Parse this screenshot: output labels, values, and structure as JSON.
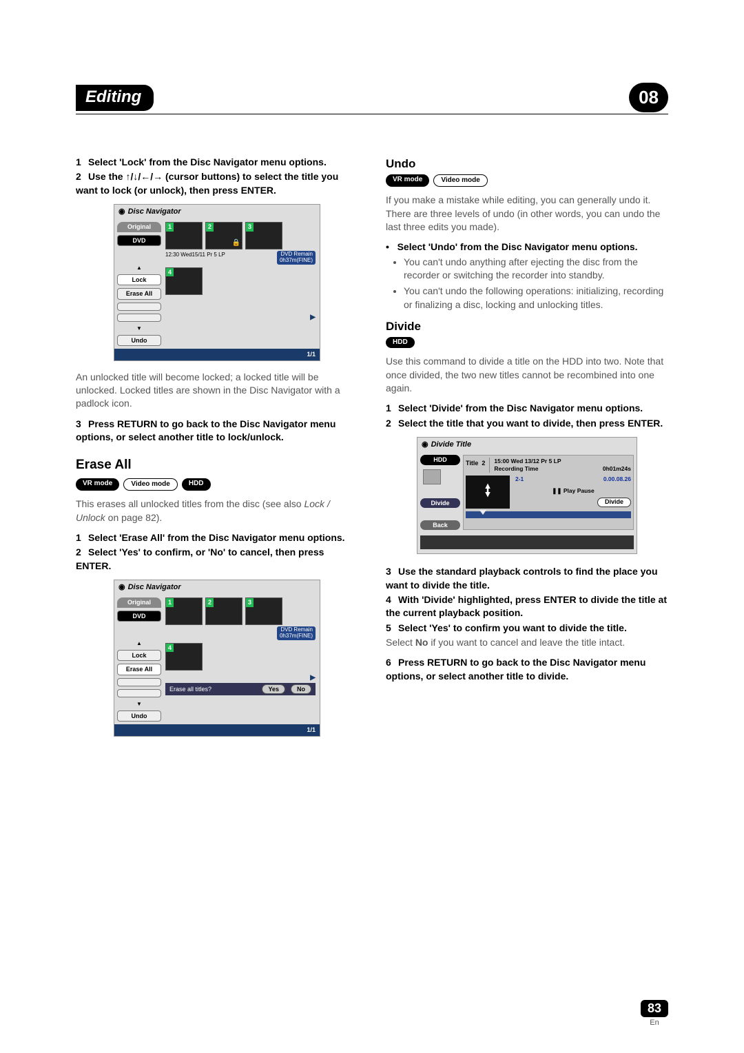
{
  "header": {
    "chapter": "Editing",
    "page_badge": "08"
  },
  "left": {
    "step1": "Select 'Lock' from the Disc Navigator menu options.",
    "step2": "Use the ↑/↓/←/→ (cursor buttons) to select the title you want to lock (or unlock), then press ENTER.",
    "after_img1": "An unlocked title will become locked; a locked title will be unlocked. Locked titles are shown in the Disc Navigator with a padlock icon.",
    "step3": "Press RETURN to go back to the Disc Navigator menu options, or select another title to lock/unlock.",
    "erase_all_h": "Erase All",
    "badges": {
      "vr": "VR mode",
      "video": "Video mode",
      "hdd": "HDD"
    },
    "erase_intro_a": "This erases all unlocked titles from the disc (see also ",
    "erase_intro_link": "Lock / Unlock",
    "erase_intro_b": " on page 82).",
    "ea_step1": "Select 'Erase All' from the Disc Navigator menu options.",
    "ea_step2": "Select 'Yes' to confirm, or 'No' to cancel, then press ENTER."
  },
  "right": {
    "undo_h": "Undo",
    "badges": {
      "vr": "VR mode",
      "video": "Video mode"
    },
    "undo_intro": "If you make a mistake while editing, you can generally undo it. There are three levels of undo (in other words, you can undo the last three edits you made).",
    "undo_bullet_lead": "Select 'Undo' from the Disc Navigator menu options.",
    "undo_b1": "You can't undo anything after ejecting the disc from the recorder or switching the recorder into standby.",
    "undo_b2": "You can't undo the following operations: initializing, recording or finalizing a disc, locking and unlocking titles.",
    "divide_h": "Divide",
    "hdd_badge": "HDD",
    "divide_intro": "Use this command to divide a title on the HDD into two. Note that once divided, the two new titles cannot be recombined into one again.",
    "dv_step1": "Select 'Divide' from the Disc Navigator menu options.",
    "dv_step2": "Select the title that you want to divide, then press ENTER.",
    "dv_step3": "Use the standard playback controls to find the place you want to divide the title.",
    "dv_step4": "With 'Divide' highlighted, press ENTER to divide the title at the current playback position.",
    "dv_step5": "Select 'Yes' to confirm you want to divide the title.",
    "dv_step5_body_a": "Select ",
    "dv_step5_body_no": "No",
    "dv_step5_body_b": " if you want to cancel and leave the title intact.",
    "dv_step6": "Press RETURN to go back to the Disc Navigator menu options, or select another title to divide."
  },
  "nav_shot": {
    "title": "Disc Navigator",
    "tab": "Original",
    "dvd": "DVD",
    "lock": "Lock",
    "erase": "Erase All",
    "undo": "Undo",
    "info_left": "12:30 Wed15/11  Pr 5   LP",
    "remain1": "DVD Remain",
    "remain2": "0h37m(FINE)",
    "page": "1/1",
    "erase_q": "Erase all titles?",
    "yes": "Yes",
    "no": "No"
  },
  "div_shot": {
    "title": "Divide Title",
    "hdd": "HDD",
    "divide": "Divide",
    "back": "Back",
    "title_lbl": "Title",
    "title_no": "2",
    "rec_line": "15:00 Wed  13/12   Pr 5    LP",
    "rec_time_lbl": "Recording Time",
    "rec_time_val": "0h01m24s",
    "pos": "2-1",
    "time": "0.00.08.26",
    "pause": "❚❚ Play Pause",
    "divide_btn": "Divide"
  },
  "footer": {
    "page": "83",
    "lang": "En"
  }
}
